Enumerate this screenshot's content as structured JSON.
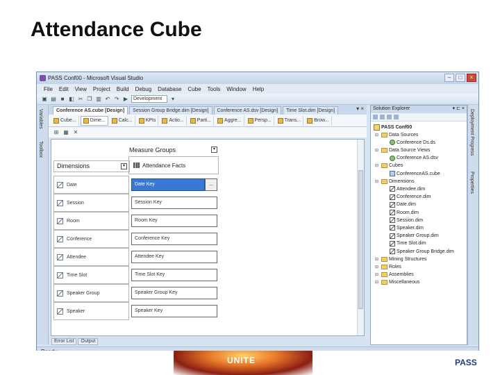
{
  "slide": {
    "title": "Attendance Cube"
  },
  "window": {
    "title": "PASS Conf00 - Microsoft Visual Studio",
    "menu": [
      "File",
      "Edit",
      "View",
      "Project",
      "Build",
      "Debug",
      "Database",
      "Cube",
      "Tools",
      "Window",
      "Help"
    ],
    "toolbar_combo": "Development"
  },
  "left_strip": {
    "items": [
      "Variables",
      "Toolbox"
    ]
  },
  "doc_tabs": [
    "Conference AS.cube [Design]",
    "Session Group Bridge.dim [Design]",
    "Conference AS.dsv [Design]",
    "Time Slot.dim [Design]"
  ],
  "designer_tabs": [
    "Cube...",
    "Dime...",
    "Calc...",
    "KPIs",
    "Actio...",
    "Parti...",
    "Aggre...",
    "Persp...",
    "Trans...",
    "Brow..."
  ],
  "design": {
    "measure_groups_label": "Measure Groups",
    "measure_group_item": "Attendance Facts",
    "dimensions_label": "Dimensions",
    "rows": [
      {
        "dimension": "Date",
        "key": "Date Key"
      },
      {
        "dimension": "Session",
        "key": "Session Key"
      },
      {
        "dimension": "Room",
        "key": "Room Key"
      },
      {
        "dimension": "Conference",
        "key": "Conference Key"
      },
      {
        "dimension": "Attendee",
        "key": "Attendee Key"
      },
      {
        "dimension": "Time Slot",
        "key": "Time Slot Key"
      },
      {
        "dimension": "Speaker Group",
        "key": "Speaker Group Key"
      },
      {
        "dimension": "Speaker",
        "key": "Speaker Key"
      }
    ]
  },
  "bottom_tabs": [
    "Error List",
    "Output"
  ],
  "status": "Ready",
  "solution_explorer": {
    "title": "Solution Explorer",
    "project": "PASS Conf00",
    "tree": [
      {
        "label": "Data Sources",
        "type": "folder",
        "level": 1
      },
      {
        "label": "Conference Ds.ds",
        "type": "ds",
        "level": 2
      },
      {
        "label": "Data Source Views",
        "type": "folder",
        "level": 1
      },
      {
        "label": "Conference AS.dsv",
        "type": "ds",
        "level": 2
      },
      {
        "label": "Cubes",
        "type": "folder",
        "level": 1
      },
      {
        "label": "ConferenceAS.cube",
        "type": "cube",
        "level": 2
      },
      {
        "label": "Dimensions",
        "type": "folder",
        "level": 1
      },
      {
        "label": "Attendee.dim",
        "type": "dim",
        "level": 2
      },
      {
        "label": "Conference.dim",
        "type": "dim",
        "level": 2
      },
      {
        "label": "Date.dim",
        "type": "dim",
        "level": 2
      },
      {
        "label": "Room.dim",
        "type": "dim",
        "level": 2
      },
      {
        "label": "Session.dim",
        "type": "dim",
        "level": 2
      },
      {
        "label": "Speaker.dim",
        "type": "dim",
        "level": 2
      },
      {
        "label": "Speaker Group.dim",
        "type": "dim",
        "level": 2
      },
      {
        "label": "Time Slot.dim",
        "type": "dim",
        "level": 2
      },
      {
        "label": "Speaker Group Bridge.dim",
        "type": "dim",
        "level": 2
      },
      {
        "label": "Mining Structures",
        "type": "folder",
        "level": 1
      },
      {
        "label": "Roles",
        "type": "folder",
        "level": 1
      },
      {
        "label": "Assemblies",
        "type": "folder",
        "level": 1
      },
      {
        "label": "Miscellaneous",
        "type": "folder",
        "level": 1
      }
    ]
  },
  "right_strip": {
    "items": [
      "Deployment Progress",
      "Properties"
    ]
  },
  "branding": {
    "event": "UNITE",
    "org": "PASS"
  },
  "colors": {
    "selection": "#3a78d6",
    "window_frame": "#6d8fb7"
  }
}
